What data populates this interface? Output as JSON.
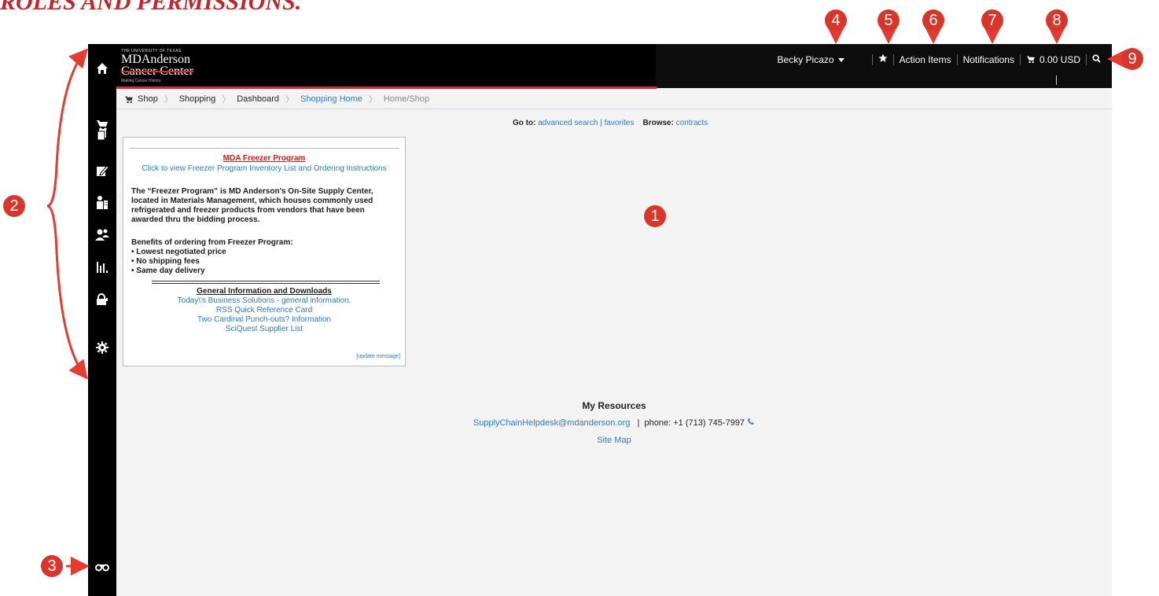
{
  "doc_heading": "ROLES AND PERMISSIONS.",
  "logo": {
    "line1": "THE UNIVERSITY OF TEXAS",
    "line2": "MDAnderson",
    "line3": "Cancer Center",
    "line4": "Making Cancer History"
  },
  "topnav": {
    "user": "Becky Picazo",
    "action_items": "Action Items",
    "notifications": "Notifications",
    "cart_total": "0.00 USD"
  },
  "sidebar": {
    "items": [
      "home-icon",
      "cart-icon",
      "documents-icon",
      "edit-icon",
      "org-icon",
      "people-icon",
      "reports-icon",
      "lock-icon",
      "gear-icon"
    ],
    "bottom": "binoculars-icon"
  },
  "breadcrumb": {
    "items": [
      "Shop",
      "Shopping",
      "Dashboard",
      "Shopping Home",
      "Home/Shop"
    ]
  },
  "goto": {
    "label": "Go to:",
    "advanced": "advanced search",
    "sep": "|",
    "favorites": "favorites",
    "browse_label": "Browse:",
    "contracts": "contracts"
  },
  "message": {
    "title": "MDA Freezer Program",
    "subtitle": "Click to view Freezer Program Inventory List and Ordering Instructions",
    "para_lines": [
      "The “Freezer Program” is MD Anderson’s On-Site Supply Center,",
      "located in Materials Management, which houses commonly used",
      "refrigerated and freezer products from vendors that have been",
      "awarded thru the bidding process."
    ],
    "benefits_title": "Benefits of ordering from Freezer Program:",
    "benefits": [
      "• Lowest negotiated price",
      "• No shipping fees",
      "• Same day delivery"
    ],
    "gi_title": "General Information and Downloads",
    "links": [
      "Today\\'s Business Solutions - general information.",
      "RSS Quick Reference Card",
      "Two Cardinal Punch-outs? Information",
      "SciQuest Supplier List"
    ],
    "update": "[update message]"
  },
  "resources": {
    "title": "My Resources",
    "email": "SupplyChainHelpdesk@mdanderson.org",
    "sep": "|",
    "phone": "phone: +1 (713) 745-7997",
    "sitemap": "Site Map"
  },
  "annotations": [
    "1",
    "2",
    "3",
    "4",
    "5",
    "6",
    "7",
    "8",
    "9"
  ],
  "colors": {
    "accent_red": "#d8282c",
    "link_blue": "#2b7ec1",
    "annotation_red": "#d9362b"
  }
}
